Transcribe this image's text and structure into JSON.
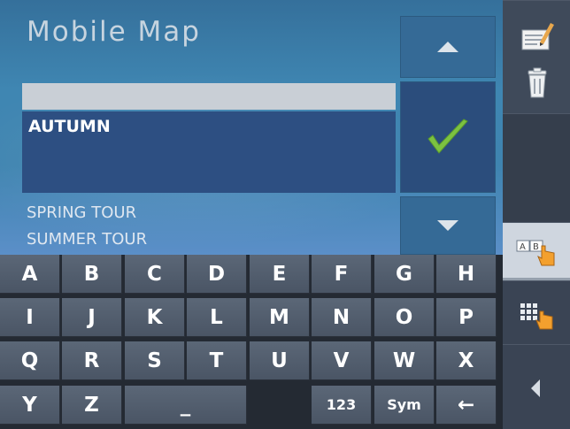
{
  "app": {
    "title": "Mobile Map"
  },
  "input": {
    "value": ""
  },
  "selected": {
    "label": "AUTUMN"
  },
  "list": {
    "items": [
      "SPRING TOUR",
      "SUMMER TOUR"
    ]
  },
  "keyboard": {
    "rows": [
      [
        "A",
        "B",
        "C",
        "D",
        "E",
        "F",
        "G",
        "H"
      ],
      [
        "I",
        "J",
        "K",
        "L",
        "M",
        "N",
        "O",
        "P"
      ],
      [
        "Q",
        "R",
        "S",
        "T",
        "U",
        "V",
        "W",
        "X"
      ]
    ],
    "bottom": {
      "y": "Y",
      "z": "Z",
      "space": "_",
      "numbers": "123",
      "symbols": "Sym",
      "backspace": "←"
    }
  },
  "icons": {
    "up": "scroll-up-icon",
    "confirm": "checkmark-icon",
    "down": "scroll-down-icon",
    "edit": "edit-icon",
    "delete": "trash-icon",
    "alpha": "alpha-keyboard-icon",
    "grid": "grid-keyboard-icon",
    "back": "back-icon"
  },
  "colors": {
    "accent": "#3f86b2",
    "confirm": "#7cc241",
    "keyboard": "#4a5565"
  }
}
